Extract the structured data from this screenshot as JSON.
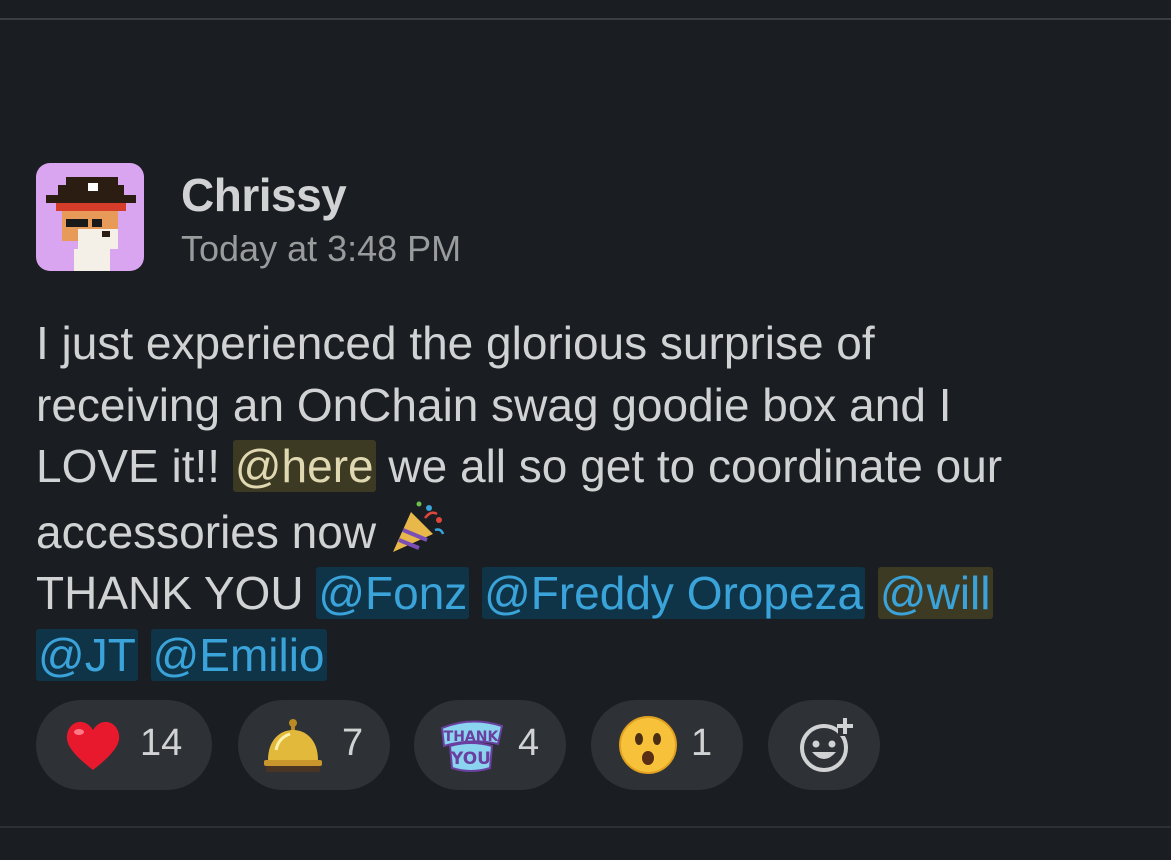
{
  "message": {
    "author": "Chrissy",
    "timestamp": "Today at 3:48 PM",
    "line1": "I just experienced the glorious surprise of",
    "line2": "receiving an OnChain swag goodie box and I",
    "line3_pre": "LOVE it!! ",
    "mention_here": "@here",
    "line3_post": " we all so get to coordinate our",
    "line4": "accessories now ",
    "line5_pre": "THANK YOU ",
    "mentions": [
      "@Fonz",
      "@Freddy Oropeza",
      "@will",
      "@JT",
      "@Emilio"
    ]
  },
  "reactions": [
    {
      "icon": "red-heart-icon",
      "count": "14"
    },
    {
      "icon": "bellhop-bell-icon",
      "count": "7"
    },
    {
      "icon": "thank-you-sticker-icon",
      "count": "4"
    },
    {
      "icon": "surprised-face-icon",
      "count": "1"
    }
  ],
  "add_reaction_icon": "add-reaction-icon"
}
